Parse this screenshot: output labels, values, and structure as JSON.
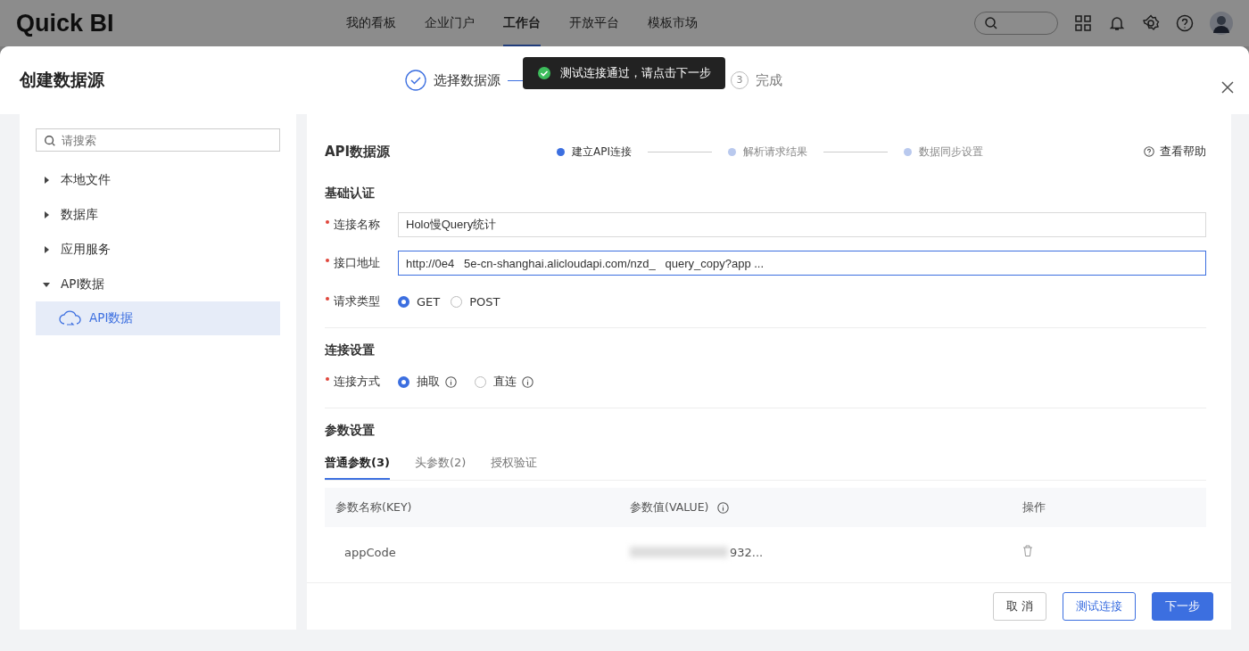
{
  "topbar": {
    "logo": "Quick BI",
    "nav": [
      {
        "label": "我的看板",
        "selected": false
      },
      {
        "label": "企业门户",
        "selected": false
      },
      {
        "label": "工作台",
        "selected": true
      },
      {
        "label": "开放平台",
        "selected": false
      },
      {
        "label": "模板市场",
        "selected": false
      }
    ]
  },
  "dialog": {
    "title": "创建数据源",
    "steps": [
      {
        "label": "选择数据源",
        "done": true
      },
      {
        "number": "3",
        "label": "完成",
        "done": false
      }
    ],
    "toast": "测试连接通过，请点击下一步"
  },
  "sidebar": {
    "search_placeholder": "请搜索",
    "items": [
      {
        "label": "本地文件",
        "expanded": false
      },
      {
        "label": "数据库",
        "expanded": false
      },
      {
        "label": "应用服务",
        "expanded": false
      },
      {
        "label": "API数据",
        "expanded": true,
        "children": [
          {
            "label": "API数据",
            "selected": true
          }
        ]
      }
    ]
  },
  "form": {
    "title": "API数据源",
    "substeps": [
      {
        "label": "建立API连接",
        "selected": true
      },
      {
        "label": "解析请求结果",
        "selected": false
      },
      {
        "label": "数据同步设置",
        "selected": false
      }
    ],
    "help": "查看帮助",
    "basic": {
      "heading": "基础认证",
      "name_label": "连接名称",
      "name_value": "Holo慢Query统计",
      "url_label": "接口地址",
      "url_value": "http://0e4   5e-cn-shanghai.alicloudapi.com/nzd_   query_copy?app ...",
      "method_label": "请求类型",
      "methods": [
        {
          "label": "GET",
          "selected": true
        },
        {
          "label": "POST",
          "selected": false
        }
      ]
    },
    "conn": {
      "heading": "连接设置",
      "mode_label": "连接方式",
      "modes": [
        {
          "label": "抽取",
          "selected": true
        },
        {
          "label": "直连",
          "selected": false
        }
      ]
    },
    "params": {
      "heading": "参数设置",
      "tabs": [
        {
          "label": "普通参数(3)",
          "selected": true
        },
        {
          "label": "头参数(2)",
          "selected": false
        },
        {
          "label": "授权验证",
          "selected": false
        }
      ],
      "columns": [
        "参数名称(KEY)",
        "参数值(VALUE)",
        "操作"
      ],
      "rows": [
        {
          "key": "appCode",
          "value": "932..."
        }
      ]
    }
  },
  "buttons": [
    {
      "label": "取 消",
      "kind": "plain"
    },
    {
      "label": "测试连接",
      "kind": "outline"
    },
    {
      "label": "下一步",
      "kind": "primary"
    }
  ]
}
